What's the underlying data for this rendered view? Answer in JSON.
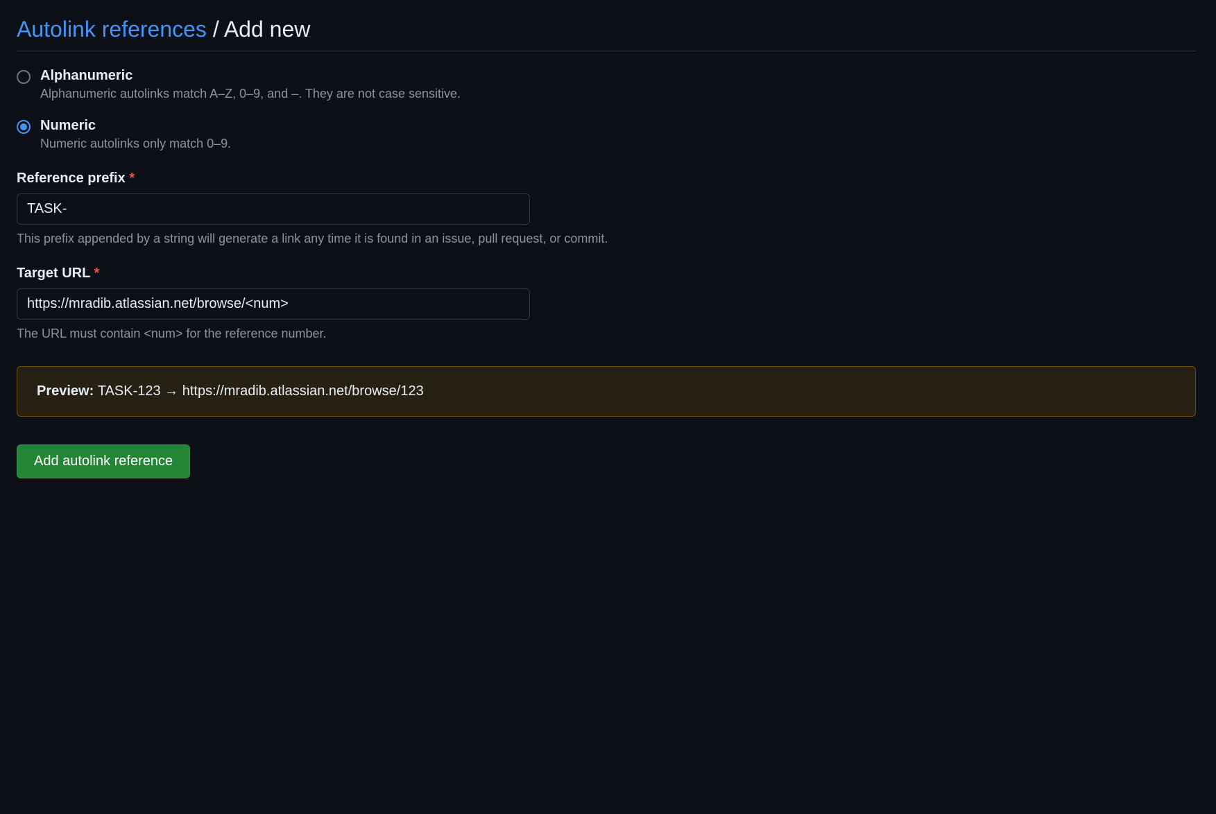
{
  "header": {
    "breadcrumb_link": "Autolink references",
    "separator": " / ",
    "current": "Add new"
  },
  "radio": {
    "alphanumeric": {
      "label": "Alphanumeric",
      "description": "Alphanumeric autolinks match A–Z, 0–9, and –. They are not case sensitive.",
      "selected": false
    },
    "numeric": {
      "label": "Numeric",
      "description": "Numeric autolinks only match 0–9.",
      "selected": true
    }
  },
  "prefix": {
    "label": "Reference prefix",
    "value": "TASK-",
    "help": "This prefix appended by a string will generate a link any time it is found in an issue, pull request, or commit."
  },
  "target": {
    "label": "Target URL",
    "value": "https://mradib.atlassian.net/browse/<num>",
    "help": "The URL must contain <num> for the reference number."
  },
  "preview": {
    "label": "Preview:",
    "text": "TASK-123 → https://mradib.atlassian.net/browse/123"
  },
  "submit": {
    "label": "Add autolink reference"
  },
  "required_marker": "*"
}
